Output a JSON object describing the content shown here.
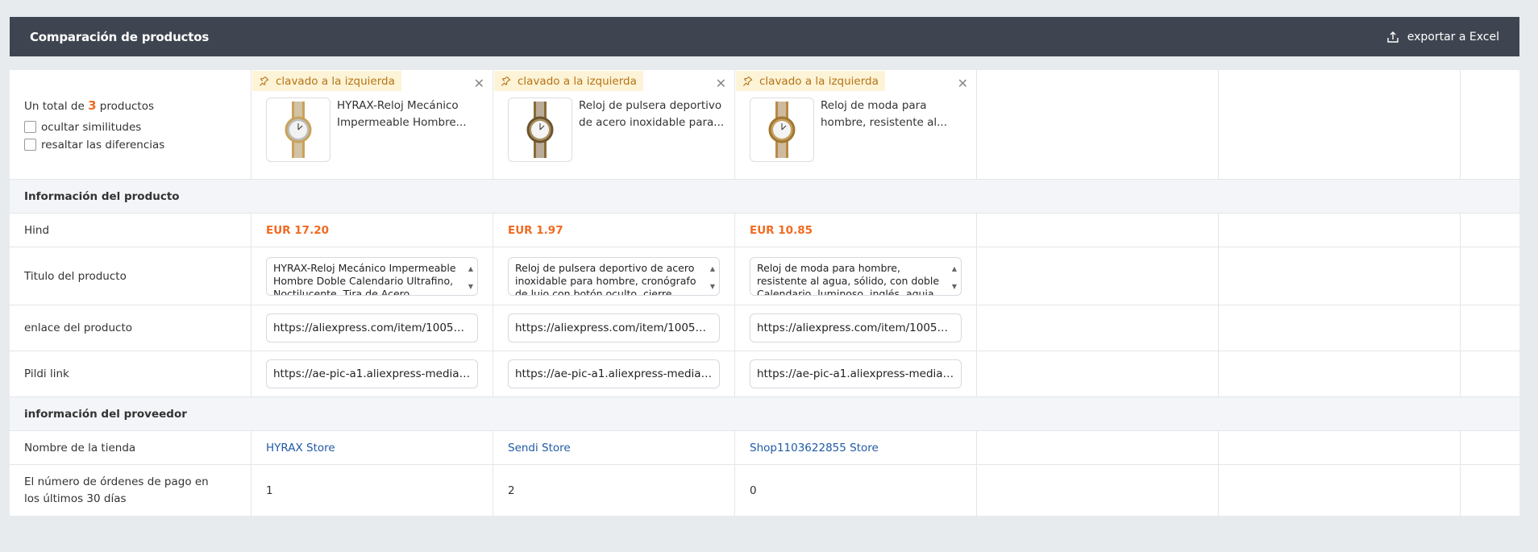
{
  "header": {
    "title": "Comparación de productos",
    "export_label": "exportar a Excel"
  },
  "summary": {
    "prefix": "Un total de ",
    "count": "3",
    "suffix": " productos",
    "hide_similar": "ocultar similitudes",
    "highlight_diff": "resaltar las diferencias"
  },
  "pin_label": "clavado a la izquierda",
  "sections": {
    "product_info": "Información del producto",
    "supplier_info": "información del proveedor"
  },
  "row_labels": {
    "price": "Hind",
    "title": "Titulo del producto",
    "link": "enlace del producto",
    "image": "Pildi link",
    "store": "Nombre de la tienda",
    "orders": "El número de órdenes de pago en los últimos 30 días"
  },
  "products": [
    {
      "name": "HYRAX-Reloj Mecánico Impermeable Hombre...",
      "price": "EUR 17.20",
      "title": "HYRAX-Reloj Mecánico Impermeable Hombre Doble Calendario Ultrafino, Noctilucente, Tira de Acero",
      "link": "https://aliexpress.com/item/1005005...",
      "image": "https://ae-pic-a1.aliexpress-media.co...",
      "store": "HYRAX Store",
      "orders": "1"
    },
    {
      "name": "Reloj de pulsera deportivo de acero inoxidable para...",
      "price": "EUR 1.97",
      "title": "Reloj de pulsera deportivo de acero inoxidable para hombre, cronógrafo de lujo con botón oculto, cierre",
      "link": "https://aliexpress.com/item/1005007...",
      "image": "https://ae-pic-a1.aliexpress-media.co...",
      "store": "Sendi Store",
      "orders": "2"
    },
    {
      "name": "Reloj de moda para hombre, resistente al...",
      "price": "EUR 10.85",
      "title": "Reloj de moda para hombre, resistente al agua, sólido, con doble Calendario, luminoso, inglés, aguja",
      "link": "https://aliexpress.com/item/1005007...",
      "image": "https://ae-pic-a1.aliexpress-media.co...",
      "store": "Shop1103622855 Store",
      "orders": "0"
    }
  ],
  "colors": {
    "header_bg": "#3f4550",
    "price": "#f06b22",
    "pin_bg": "#fdf3d6",
    "pin_text": "#b57416",
    "store_link": "#1f5aa6"
  }
}
